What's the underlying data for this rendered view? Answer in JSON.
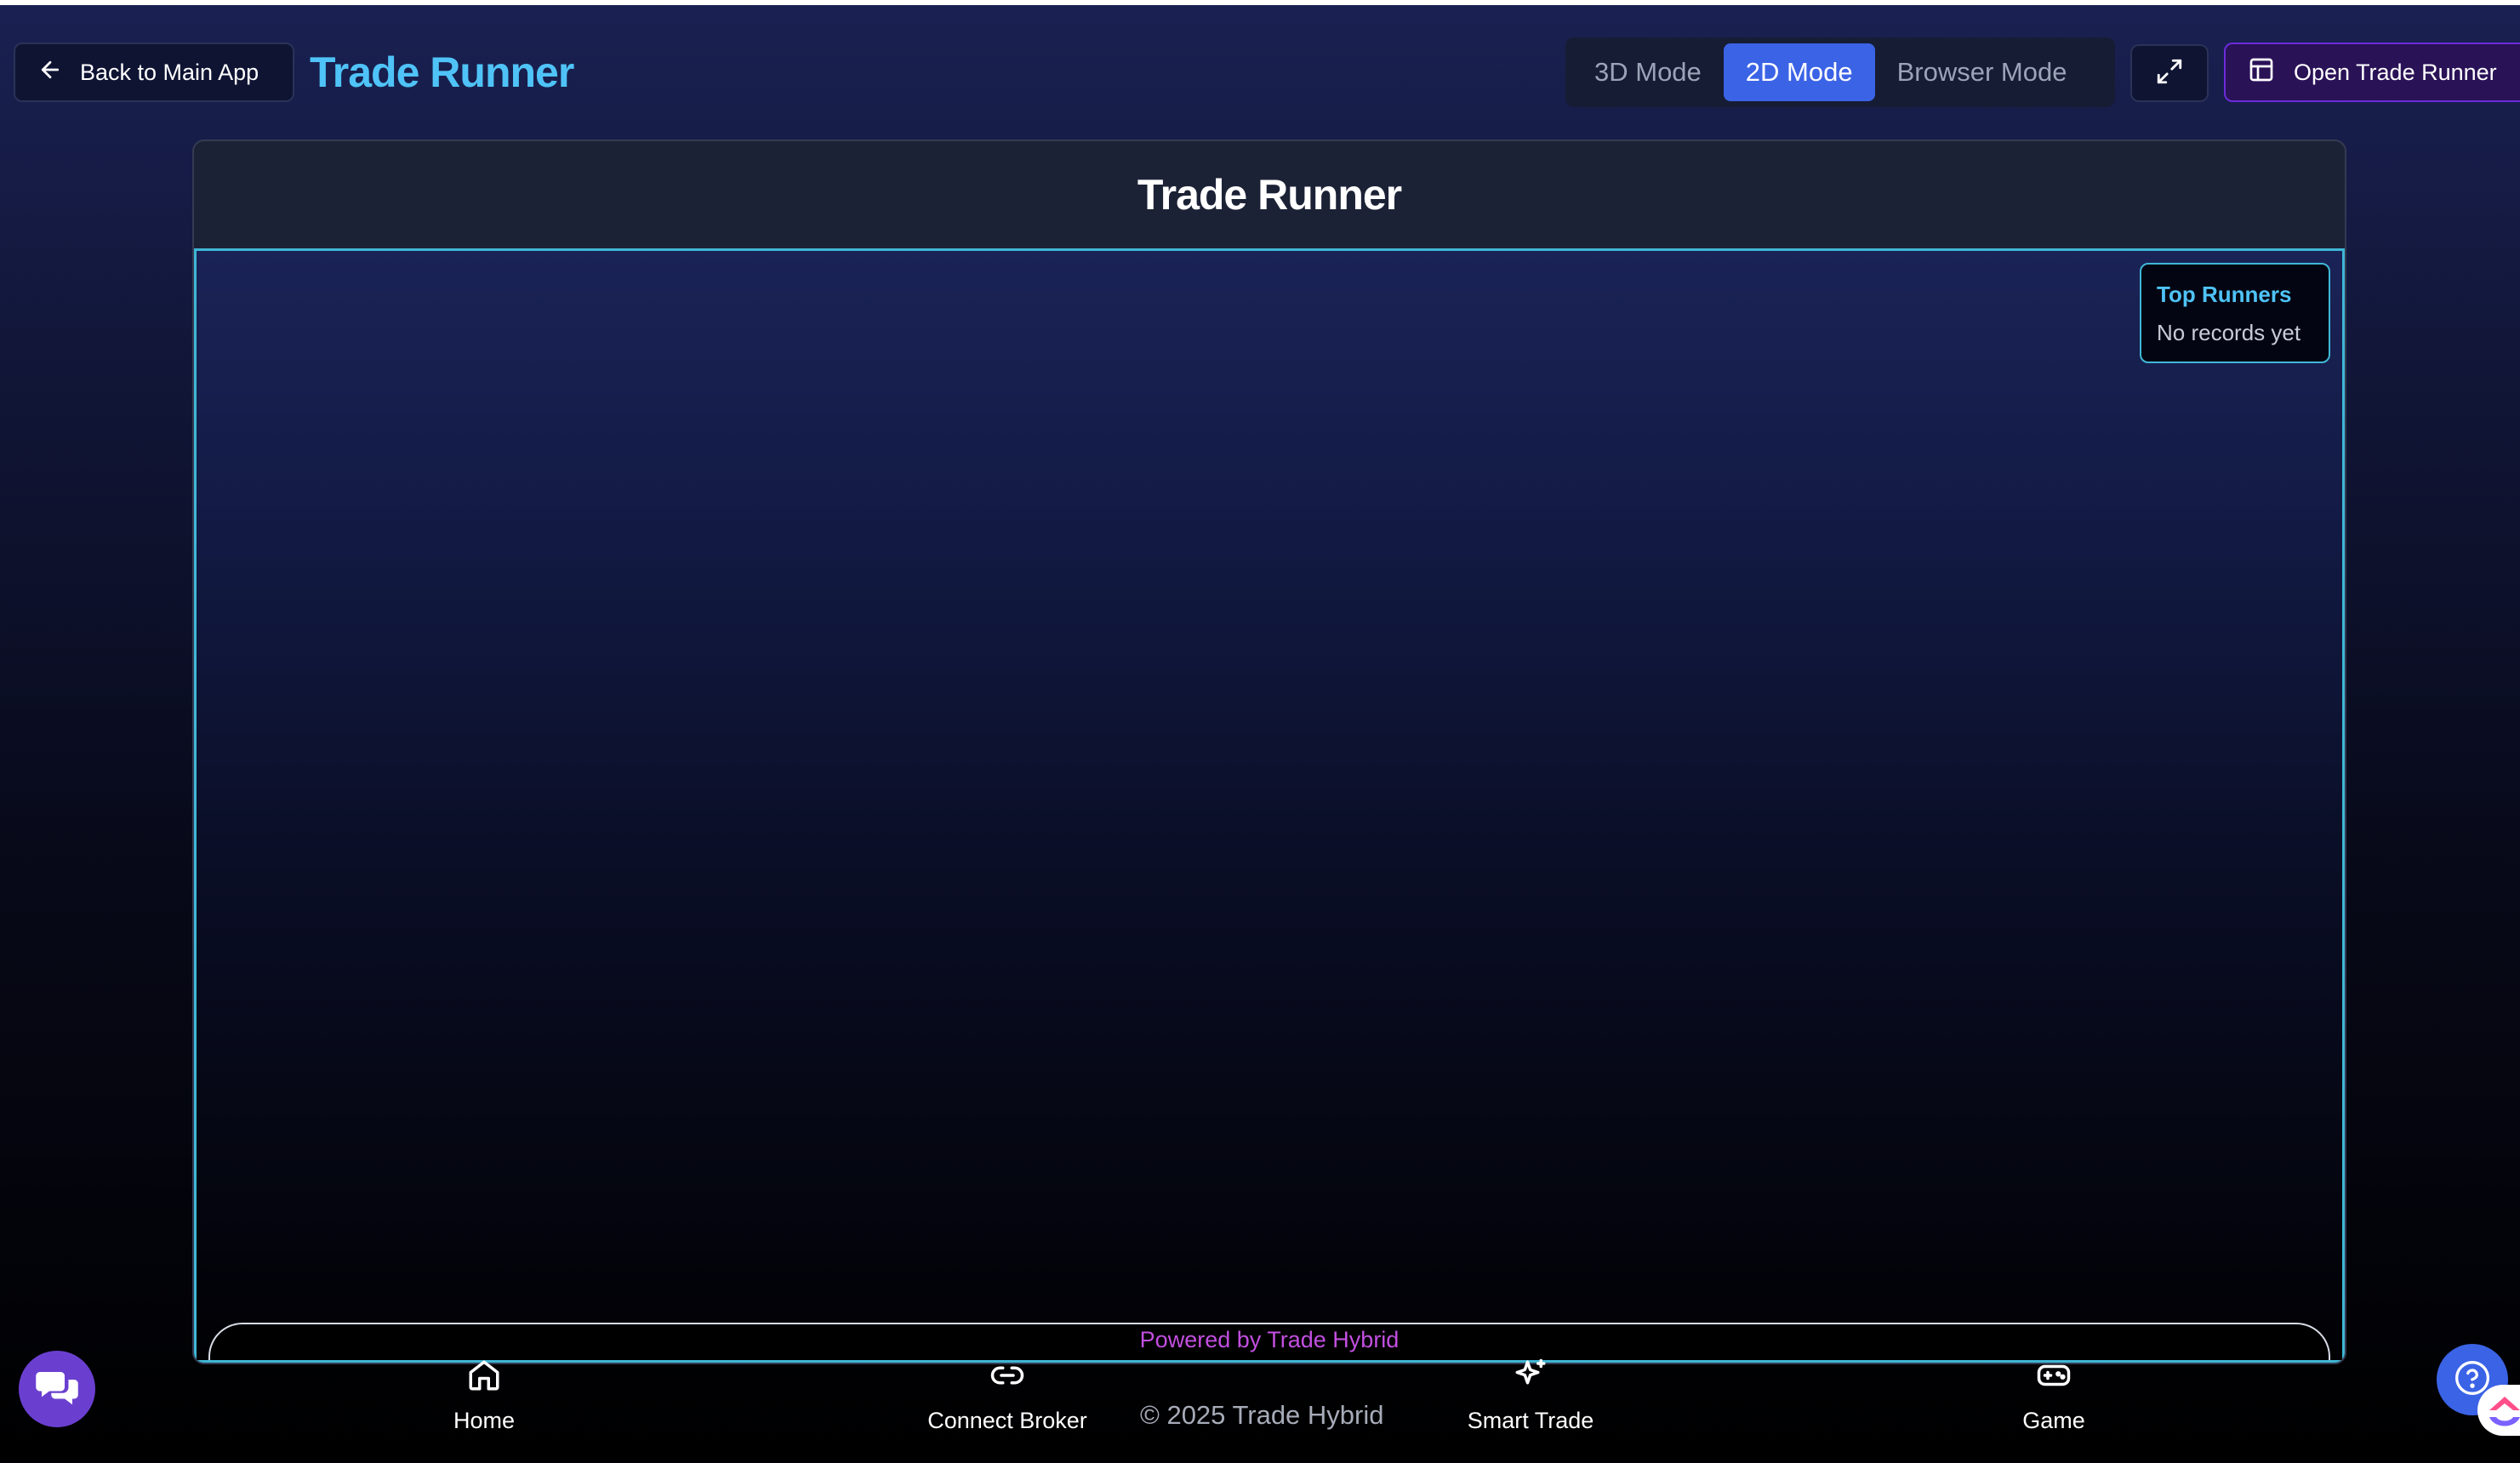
{
  "header": {
    "back_label": "Back to Main App",
    "app_title": "Trade Runner",
    "modes": [
      {
        "label": "3D Mode",
        "active": false
      },
      {
        "label": "2D Mode",
        "active": true
      },
      {
        "label": "Browser Mode",
        "active": false
      }
    ],
    "open_label": "Open Trade Runner"
  },
  "panel": {
    "title": "Trade Runner",
    "leaderboard": {
      "title": "Top Runners",
      "empty_text": "No records yet"
    },
    "powered_by": "Powered by Trade Hybrid"
  },
  "bottom_nav": {
    "items": [
      {
        "label": "Home",
        "icon": "home-icon"
      },
      {
        "label": "Connect Broker",
        "icon": "link-icon"
      },
      {
        "label": "Smart Trade",
        "icon": "sparkles-icon"
      },
      {
        "label": "Game",
        "icon": "gamepad-icon"
      }
    ],
    "copyright": "© 2025 Trade Hybrid"
  },
  "colors": {
    "accent_cyan": "#4fc3f7",
    "active_mode": "#3b63e6",
    "open_button": "#6c2bd9",
    "powered_text": "#c24fe0",
    "chat_button": "#6a3fd0"
  }
}
